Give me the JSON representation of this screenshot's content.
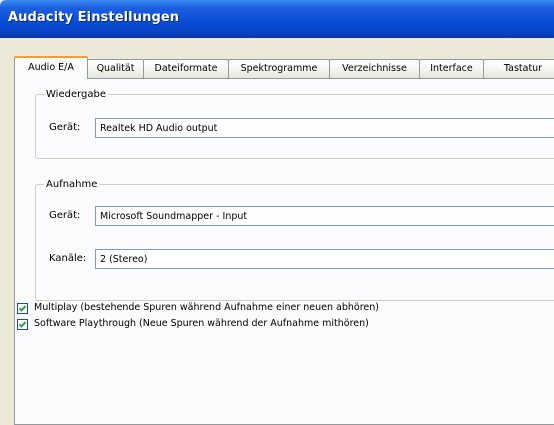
{
  "window": {
    "title": "Audacity Einstellungen"
  },
  "tabs": [
    {
      "label": "Audio E/A",
      "active": true
    },
    {
      "label": "Qualität",
      "active": false
    },
    {
      "label": "Dateiformate",
      "active": false
    },
    {
      "label": "Spektrogramme",
      "active": false
    },
    {
      "label": "Verzeichnisse",
      "active": false
    },
    {
      "label": "Interface",
      "active": false
    },
    {
      "label": "Tastatur",
      "active": false
    }
  ],
  "playback": {
    "group_label": "Wiedergabe",
    "device_label": "Gerät:",
    "device_value": "Realtek HD Audio output"
  },
  "recording": {
    "group_label": "Aufnahme",
    "device_label": "Gerät:",
    "device_value": "Microsoft Soundmapper - Input",
    "channels_label": "Kanäle:",
    "channels_value": "2 (Stereo)"
  },
  "options": {
    "multiplay_label": "Multiplay (bestehende Spuren während Aufnahme einer neuen abhören)",
    "multiplay_checked": true,
    "playthrough_label": "Software Playthrough (Neue Spuren während der Aufnahme mithören)",
    "playthrough_checked": true
  },
  "colors": {
    "titlebar": "#0a4fd8",
    "active_tab_accent": "#f0a030",
    "dialog_bg": "#ece9d8"
  }
}
